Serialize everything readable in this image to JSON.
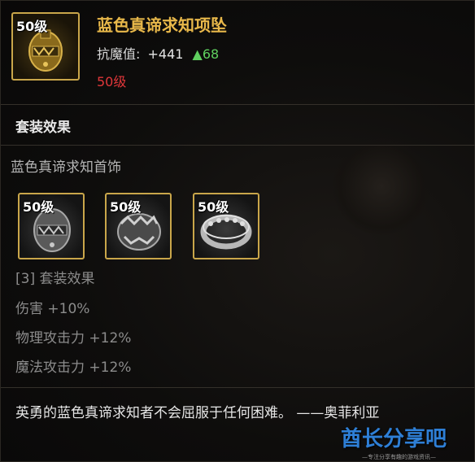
{
  "item": {
    "icon_level": "50级",
    "name": "蓝色真谛求知项坠",
    "stat_label": "抗魔值:",
    "stat_value": "+441",
    "stat_arrow": "▲",
    "stat_bonus": "68",
    "level_requirement": "50级"
  },
  "set": {
    "section_title": "套装效果",
    "name": "蓝色真谛求知首饰",
    "pieces": [
      {
        "level": "50级",
        "icon": "bracelet-icon"
      },
      {
        "level": "50级",
        "icon": "necklace-icon"
      },
      {
        "level": "50级",
        "icon": "ring-icon"
      }
    ],
    "effect_header": "[3] 套装效果",
    "effects": [
      "伤害 +10%",
      "物理攻击力 +12%",
      "魔法攻击力 +12%"
    ]
  },
  "flavor_text": "英勇的蓝色真谛求知者不会屈服于任何困难。 ——奥菲利亚",
  "watermark": {
    "title": "酋长分享吧",
    "subtitle": "—专注分享有趣的游戏资讯—"
  },
  "colors": {
    "name": "#e8b84a",
    "level_req": "#e0373a",
    "bonus": "#5fd05f",
    "frame": "#c9a64a"
  }
}
